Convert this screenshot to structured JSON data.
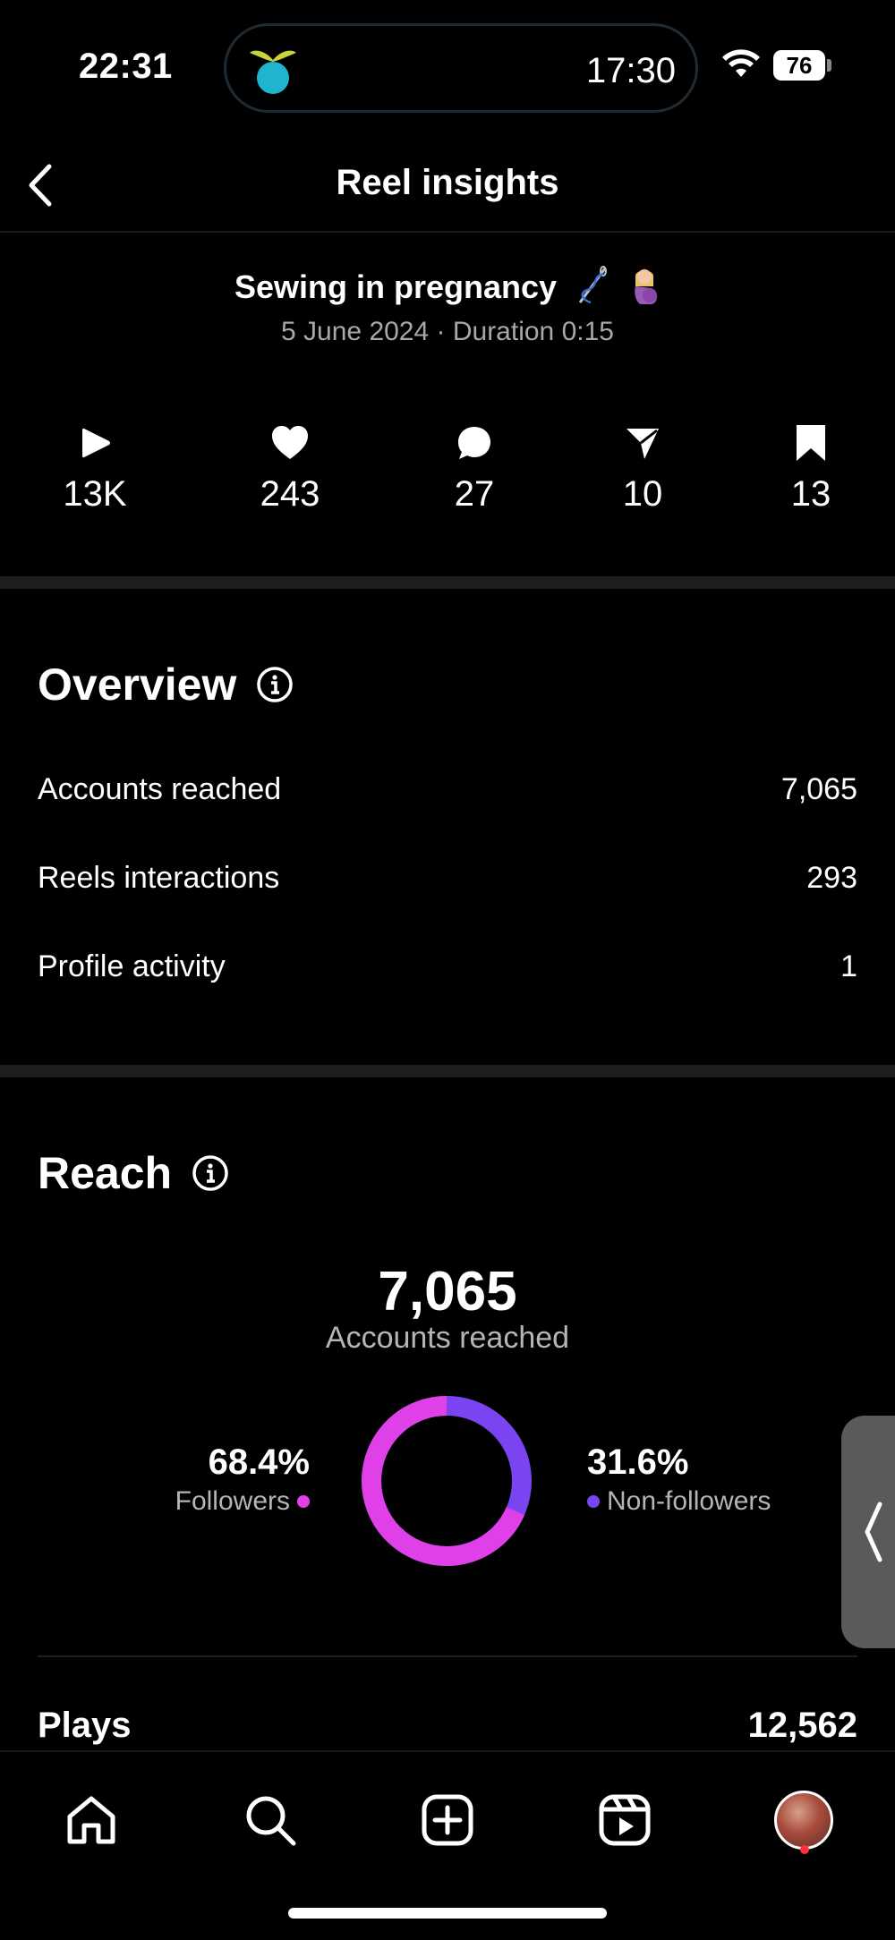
{
  "status_bar": {
    "time": "22:31",
    "island_time": "17:30",
    "battery": "76"
  },
  "header": {
    "title": "Reel insights"
  },
  "reel": {
    "title": "Sewing in pregnancy",
    "meta": "5 June 2024 · Duration 0:15"
  },
  "stats": [
    {
      "icon": "play-icon",
      "value": "13K"
    },
    {
      "icon": "heart-icon",
      "value": "243"
    },
    {
      "icon": "comment-icon",
      "value": "27"
    },
    {
      "icon": "share-icon",
      "value": "10"
    },
    {
      "icon": "bookmark-icon",
      "value": "13"
    }
  ],
  "overview": {
    "title": "Overview",
    "rows": [
      {
        "label": "Accounts reached",
        "value": "7,065"
      },
      {
        "label": "Reels interactions",
        "value": "293"
      },
      {
        "label": "Profile activity",
        "value": "1"
      }
    ]
  },
  "reach": {
    "title": "Reach",
    "total": "7,065",
    "total_label": "Accounts reached",
    "followers_pct": "68.4%",
    "followers_label": "Followers",
    "nonfollowers_pct": "31.6%",
    "nonfollowers_label": "Non-followers",
    "followers_fraction": 0.684,
    "colors": {
      "followers": "#e040e8",
      "nonfollowers": "#7a44f0"
    }
  },
  "plays": {
    "label": "Plays",
    "value": "12,562"
  },
  "nav": [
    "home-icon",
    "search-icon",
    "create-icon",
    "reels-icon",
    "profile-avatar"
  ]
}
